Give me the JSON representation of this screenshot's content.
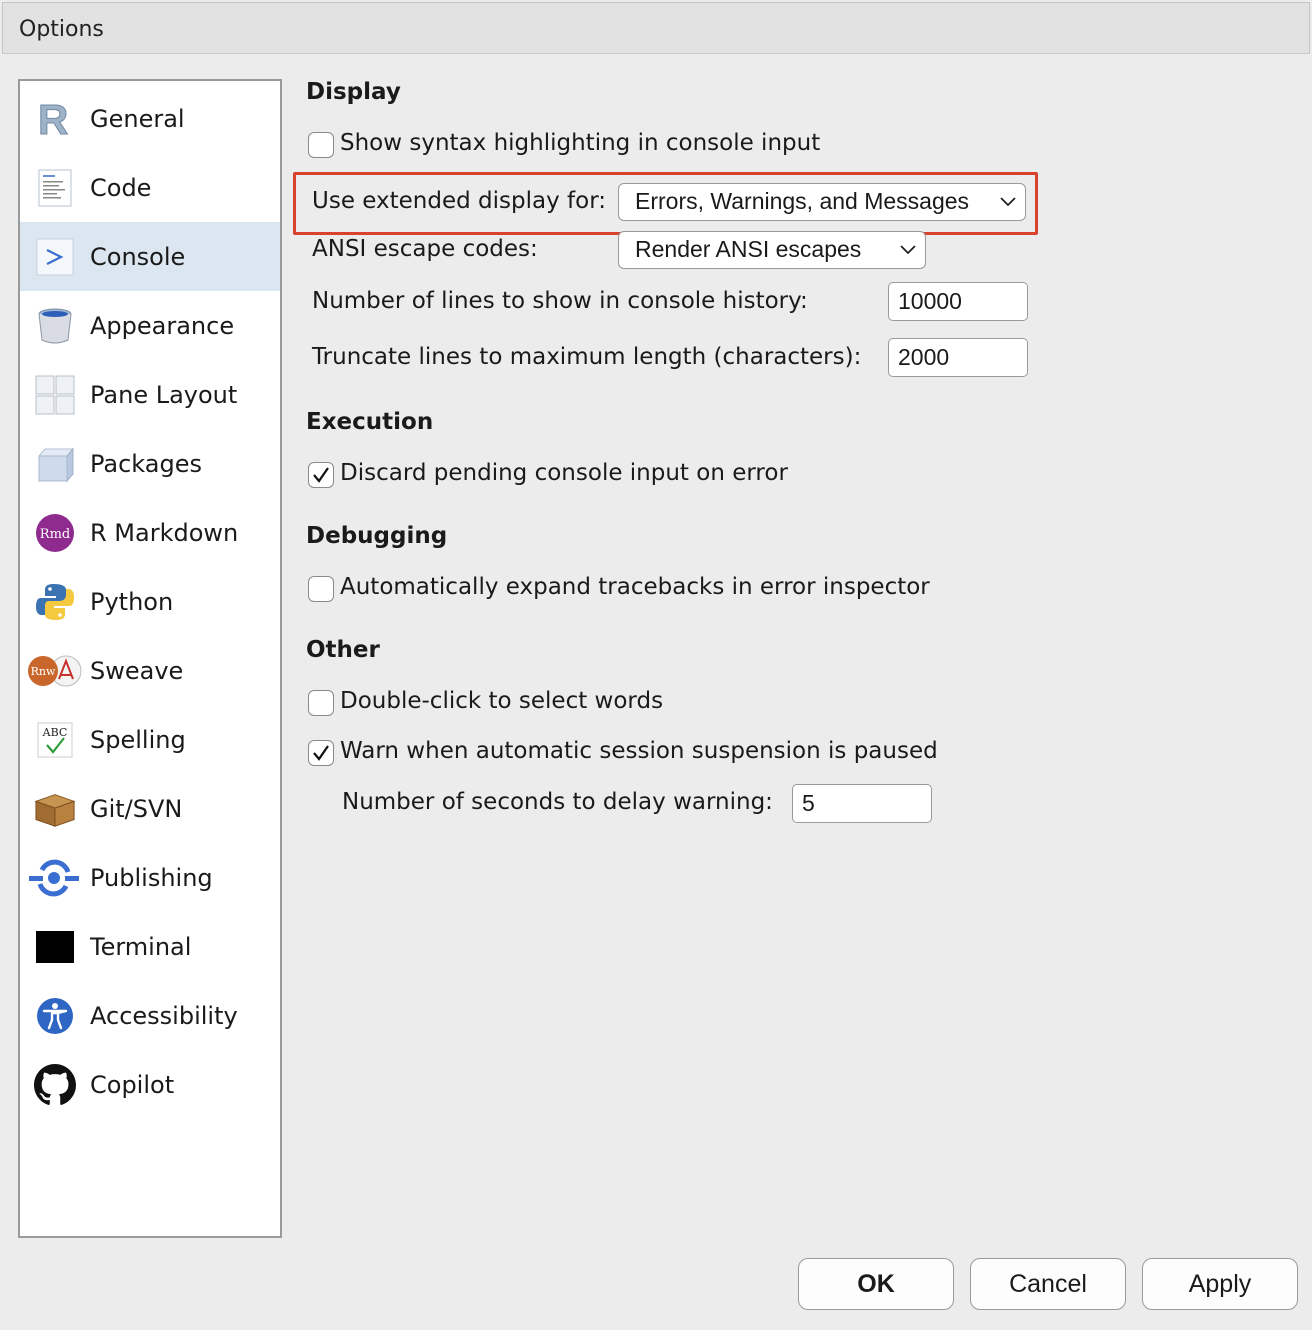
{
  "window": {
    "title": "Options"
  },
  "sidebar": {
    "items": [
      {
        "label": "General",
        "icon": "r-logo-icon"
      },
      {
        "label": "Code",
        "icon": "code-document-icon"
      },
      {
        "label": "Console",
        "icon": "console-prompt-icon",
        "selected": true
      },
      {
        "label": "Appearance",
        "icon": "paint-bucket-icon"
      },
      {
        "label": "Pane Layout",
        "icon": "pane-layout-icon"
      },
      {
        "label": "Packages",
        "icon": "package-cube-icon"
      },
      {
        "label": "R Markdown",
        "icon": "rmd-icon",
        "badge": "Rmd"
      },
      {
        "label": "Python",
        "icon": "python-icon"
      },
      {
        "label": "Sweave",
        "icon": "sweave-icon",
        "badge": "Rnw"
      },
      {
        "label": "Spelling",
        "icon": "spelling-abc-icon",
        "badge": "ABC"
      },
      {
        "label": "Git/SVN",
        "icon": "git-box-icon"
      },
      {
        "label": "Publishing",
        "icon": "publishing-icon"
      },
      {
        "label": "Terminal",
        "icon": "terminal-icon"
      },
      {
        "label": "Accessibility",
        "icon": "accessibility-icon"
      },
      {
        "label": "Copilot",
        "icon": "github-icon"
      }
    ]
  },
  "display": {
    "title": "Display",
    "syntax_highlight_label": "Show syntax highlighting in console input",
    "syntax_highlight_checked": false,
    "extended_display_label": "Use extended display for:",
    "extended_display_value": "Errors, Warnings, and Messages",
    "ansi_label": "ANSI escape codes:",
    "ansi_value": "Render ANSI escapes",
    "history_label": "Number of lines to show in console history:",
    "history_value": "10000",
    "truncate_label": "Truncate lines to maximum length (characters):",
    "truncate_value": "2000"
  },
  "execution": {
    "title": "Execution",
    "discard_label": "Discard pending console input on error",
    "discard_checked": true
  },
  "debugging": {
    "title": "Debugging",
    "tracebacks_label": "Automatically expand tracebacks in error inspector",
    "tracebacks_checked": false
  },
  "other": {
    "title": "Other",
    "double_click_label": "Double-click to select words",
    "double_click_checked": false,
    "warn_suspension_label": "Warn when automatic session suspension is paused",
    "warn_suspension_checked": true,
    "delay_label": "Number of seconds to delay warning:",
    "delay_value": "5"
  },
  "buttons": {
    "ok": "OK",
    "cancel": "Cancel",
    "apply": "Apply"
  },
  "colors": {
    "highlight": "#d9432e",
    "selected_bg": "#dce6f1"
  }
}
